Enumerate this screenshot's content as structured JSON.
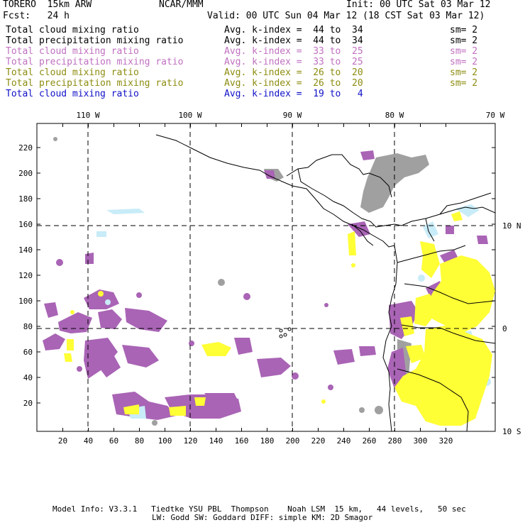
{
  "header": {
    "model": "TORERO  15km ARW",
    "org": "NCAR/MMM",
    "init": "Init: 00 UTC Sat 03 Mar 12",
    "fcst": "Fcst:   24 h",
    "valid": "Valid: 00 UTC Sun 04 Mar 12 (18 CST Sat 03 Mar 12)"
  },
  "legend": [
    {
      "field": "Total cloud mixing ratio",
      "kindex": "Avg. k-index =  44 to  34",
      "sm": "sm= 2",
      "color": "#000000"
    },
    {
      "field": "Total precipitation mixing ratio",
      "kindex": "Avg. k-index =  44 to  34",
      "sm": "sm= 2",
      "color": "#000000"
    },
    {
      "field": "Total cloud mixing ratio",
      "kindex": "Avg. k-index =  33 to  25",
      "sm": "sm= 2",
      "color": "#c070c0"
    },
    {
      "field": "Total precipitation mixing ratio",
      "kindex": "Avg. k-index =  33 to  25",
      "sm": "sm= 2",
      "color": "#c070c0"
    },
    {
      "field": "Total cloud mixing ratio",
      "kindex": "Avg. k-index =  26 to  20",
      "sm": "sm= 2",
      "color": "#8c8c10"
    },
    {
      "field": "Total precipitation mixing ratio",
      "kindex": "Avg. k-index =  26 to  20",
      "sm": "sm= 2",
      "color": "#8c8c10"
    },
    {
      "field": "Total cloud mixing ratio",
      "kindex": "Avg. k-index =  19 to   4",
      "sm": "",
      "color": "#1010c8"
    }
  ],
  "map": {
    "top_lon_labels": [
      "110 W",
      "100 W",
      "90 W",
      "80 W",
      "70 W"
    ],
    "right_lat_labels": [
      "10 N",
      "0",
      "10 S"
    ],
    "left_ticks": [
      "20",
      "40",
      "60",
      "80",
      "100",
      "120",
      "140",
      "160",
      "180",
      "200",
      "220"
    ],
    "bottom_ticks": [
      "20",
      "40",
      "60",
      "80",
      "100",
      "120",
      "140",
      "160",
      "180",
      "200",
      "220",
      "240",
      "260",
      "280",
      "300",
      "320"
    ],
    "colors": {
      "purple": "#a964b5",
      "yellow": "#ffff36",
      "gray": "#a0a0a0",
      "lightblue": "#c8ecf8",
      "coast": "#000000"
    }
  },
  "footer": {
    "line1": "Model Info: V3.3.1   Tiedtke YSU PBL  Thompson    Noah LSM  15 km,   44 levels,   50 sec",
    "line2": "LW: Godd SW: Goddard DIFF: simple KM: 2D Smagor"
  }
}
